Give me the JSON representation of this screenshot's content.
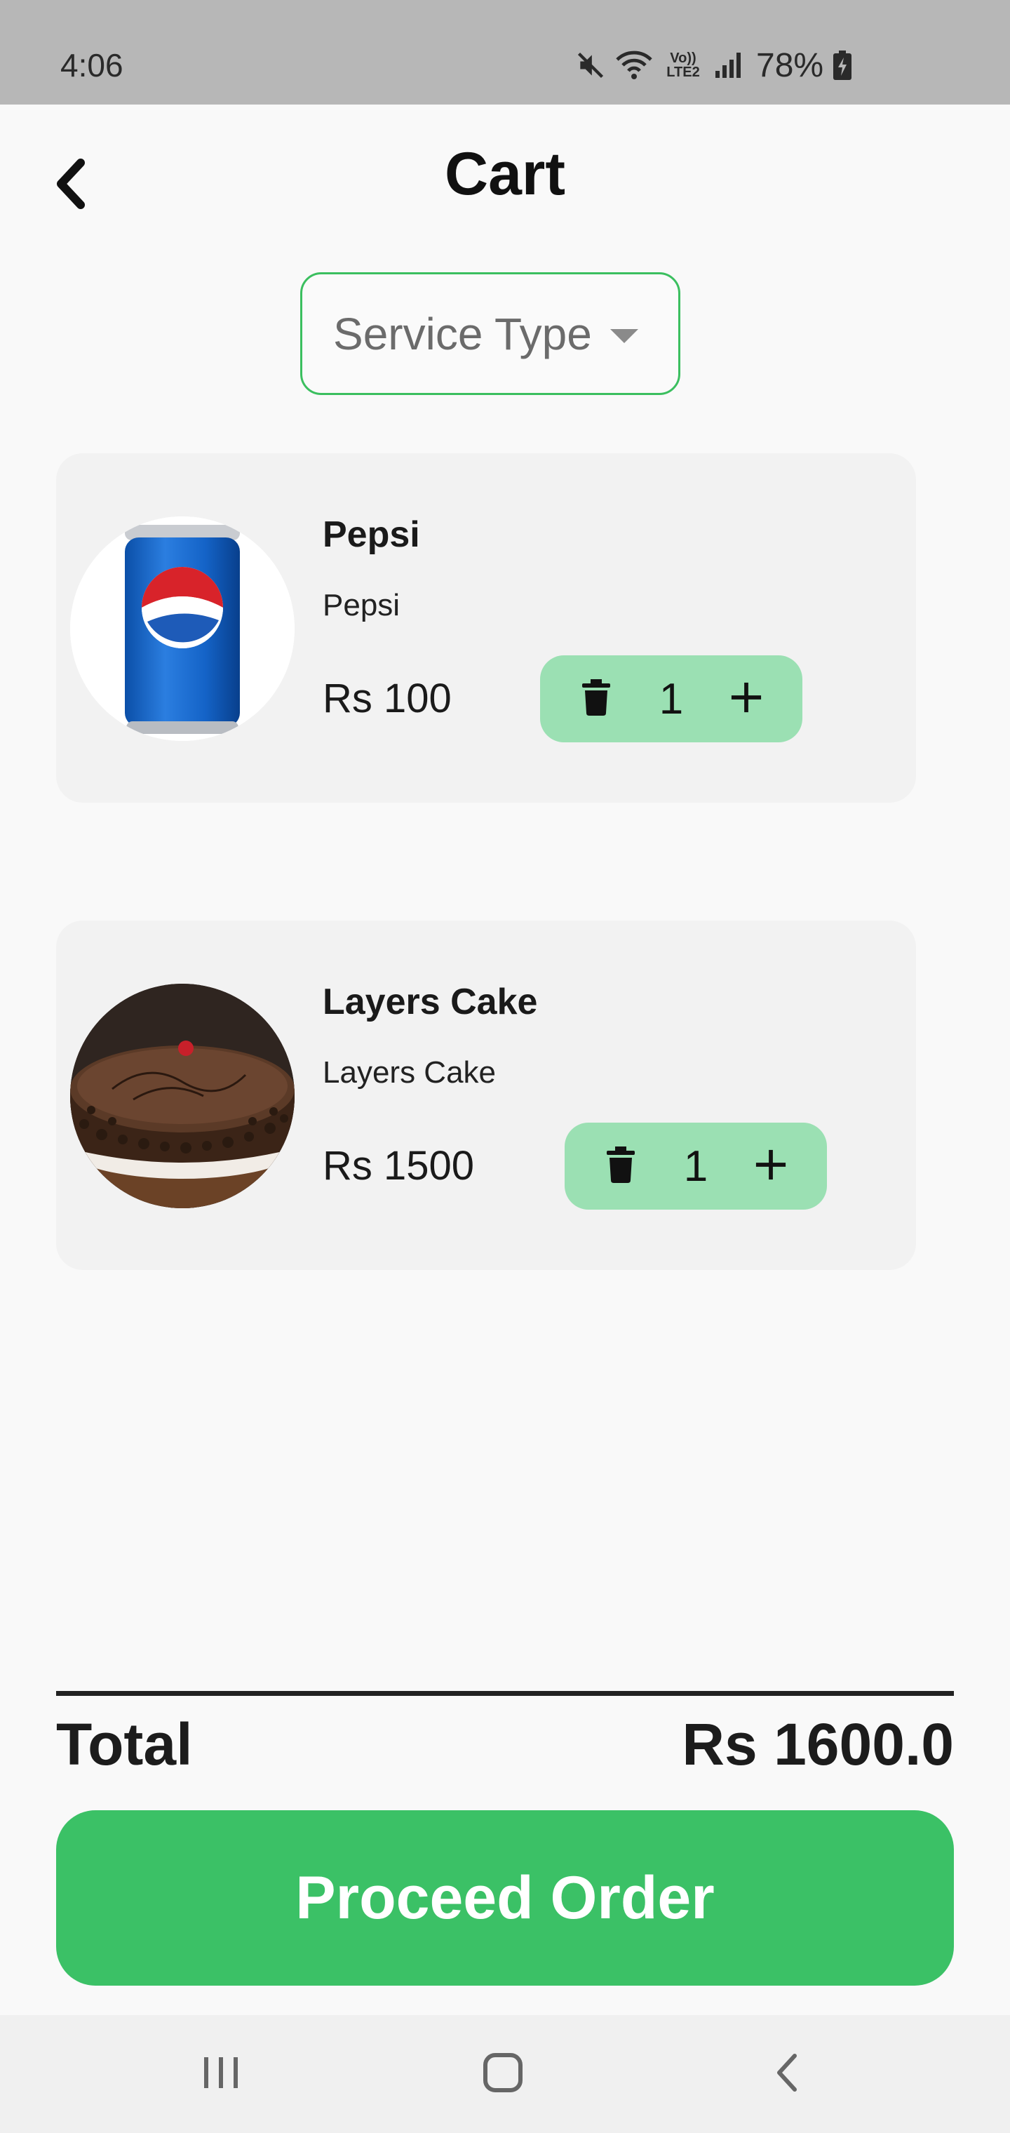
{
  "status_bar": {
    "time": "4:06",
    "battery": "78%",
    "network_label": "Vo)) LTE2",
    "icons": [
      "mute-icon",
      "wifi-icon",
      "lte-icon",
      "signal-icon",
      "battery-charging-icon"
    ]
  },
  "header": {
    "title": "Cart",
    "back_icon": "chevron-left-icon"
  },
  "service_type": {
    "label": "Service Type",
    "caret_icon": "caret-down-icon"
  },
  "cart_items": [
    {
      "name": "Pepsi",
      "description": "Pepsi",
      "price": "Rs 100",
      "quantity": "1",
      "image": "pepsi-can"
    },
    {
      "name": "Layers Cake",
      "description": "Layers Cake",
      "price": "Rs 1500",
      "quantity": "1",
      "image": "chocolate-cake"
    }
  ],
  "summary": {
    "total_label": "Total",
    "total_value": "Rs 1600.0"
  },
  "actions": {
    "proceed_label": "Proceed Order"
  },
  "nav_bar": {
    "icons": [
      "recent-apps-icon",
      "home-icon",
      "back-icon"
    ]
  },
  "colors": {
    "accent": "#3bc166",
    "qty_bg": "#9be0b3",
    "card_bg": "#f2f2f2",
    "status_bar_bg": "#b7b7b7"
  }
}
